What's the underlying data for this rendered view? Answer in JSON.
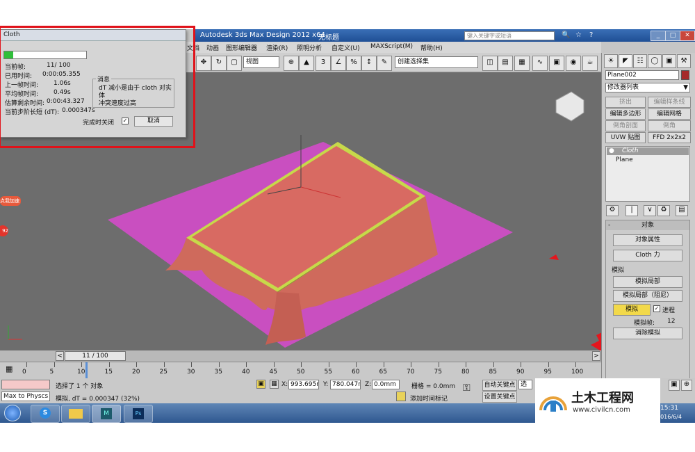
{
  "window": {
    "title": "Autodesk 3ds Max Design 2012 x64",
    "file": "无标题",
    "search_placeholder": "键入关键字或短语"
  },
  "menu": {
    "items": [
      "文档",
      "动画",
      "图形编辑器",
      "渲染(R)",
      "照明分析",
      "自定义(U)",
      "MAXScript(M)",
      "帮助(H)"
    ]
  },
  "toolbar": {
    "view_select": "视图",
    "selection_set": "创建选择集"
  },
  "cloth_dialog": {
    "title": "Cloth",
    "progress_fraction": 0.11,
    "labels": {
      "current_frame": "当前帧:",
      "elapsed": "已用时间:",
      "last_frame": "上一帧时间:",
      "avg_frame": "平均帧时间:",
      "remaining": "估算剩余时间:",
      "step": "当前步阶长短 (dT):"
    },
    "values": {
      "current_frame": "11/ 100",
      "elapsed": "0:00:05.355",
      "last_frame": "1.06s",
      "avg_frame": "0.49s",
      "remaining": "0:00:43.327",
      "step": "0.000347s"
    },
    "message_title": "消息",
    "message_text": "dT 减小是由于 cloth 对实体\n冲突速度过高",
    "close_on_finish": "完成时关闭",
    "cancel": "取消"
  },
  "side_badge": {
    "label": "点我加速",
    "value": "92"
  },
  "command_panel": {
    "object_name": "Plane002",
    "modifier_list": "修改器列表",
    "buttons": {
      "extrude": "挤出",
      "edit_spline": "编辑样条线",
      "edit_poly": "编辑多边形",
      "edit_mesh": "编辑网格",
      "face_extrude": "倒角剖面",
      "chamfer": "倒角",
      "uvw_map": "UVW 贴图",
      "ffd": "FFD 2x2x2"
    },
    "stack": [
      "Cloth",
      "Plane"
    ],
    "rollout_object": "对象",
    "object_properties": "对象属性",
    "cloth_forces": "Cloth 力",
    "simulation_group": "模拟",
    "sim_local": "模拟局部",
    "sim_local_damped": "模拟局部（阻尼）",
    "simulate": "模拟",
    "progress": "进程",
    "sim_frame_label": "模拟帧:",
    "sim_frame_value": "12",
    "erase_sim": "消除模拟"
  },
  "timeline": {
    "slider": "11 / 100",
    "ticks": [
      "0",
      "5",
      "10",
      "15",
      "20",
      "25",
      "30",
      "35",
      "40",
      "45",
      "50",
      "55",
      "60",
      "65",
      "70",
      "75",
      "80",
      "85",
      "90",
      "95",
      "100"
    ]
  },
  "status": {
    "maxscript": "Max to Physcs (",
    "selected": "选择了 1 个 对象",
    "prompt": "模拟, dT = 0.000347 (32%)",
    "x_label": "X:",
    "x_value": "993.695mm",
    "y_label": "Y:",
    "y_value": "780.047mm",
    "z_label": "Z:",
    "z_value": "0.0mm",
    "grid": "栅格 = 0.0mm",
    "add_time_tag": "添加时间标记",
    "auto_key": "自动关键点",
    "set_key": "设置关键点",
    "selected_obj": "选"
  },
  "taskbar": {
    "time": "15:31",
    "date": "2016/6/4"
  },
  "watermark": {
    "cn": "土木工程网",
    "url": "www.civilcn.com"
  },
  "colors": {
    "cloth": "#d86a62",
    "ground": "#c94fc0",
    "frame": "#c7d94a",
    "arrow": "#e4161d",
    "highlight": "#f2d94a"
  }
}
